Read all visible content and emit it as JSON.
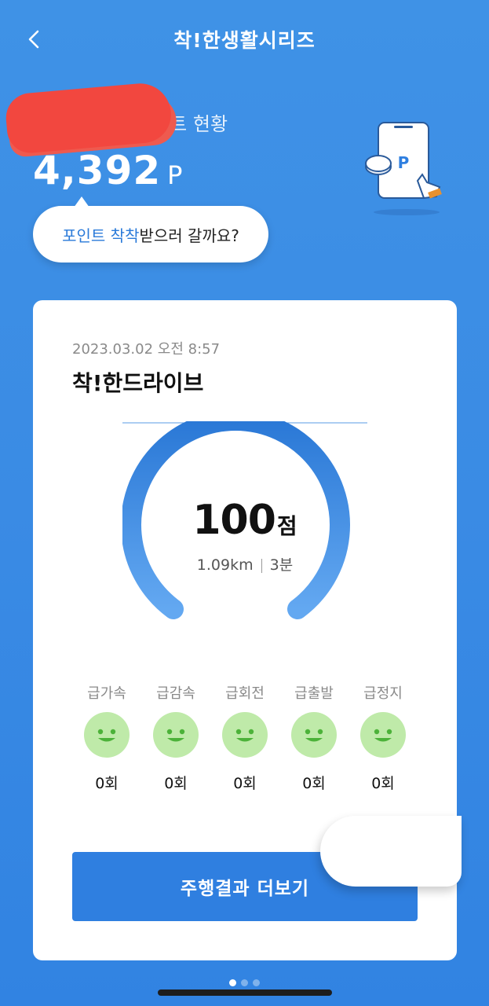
{
  "header": {
    "title": "착!한생활시리즈"
  },
  "points": {
    "label_visible": "포인트 현황",
    "value": "4,392",
    "unit": "P",
    "illustration_letter": "P"
  },
  "bubble": {
    "accent": "포인트 착착",
    "rest": " 받으러 갈까요?"
  },
  "card": {
    "date": "2023.03.02 오전 8:57",
    "title": "착!한드라이브",
    "score": {
      "value": "100",
      "unit": "점",
      "distance": "1.09km",
      "duration": "3분"
    },
    "metrics": [
      {
        "label": "급가속",
        "count": "0회"
      },
      {
        "label": "급감속",
        "count": "0회"
      },
      {
        "label": "급회전",
        "count": "0회"
      },
      {
        "label": "급출발",
        "count": "0회"
      },
      {
        "label": "급정지",
        "count": "0회"
      }
    ],
    "cta_label": "주행결과 더보기"
  },
  "pager": {
    "count": 3,
    "active_index": 0
  },
  "colors": {
    "background": "#3a8be4",
    "accent": "#2f7fe0",
    "gauge_start": "#2a78d6",
    "gauge_end": "#63a8f1",
    "smile_fill": "#bfeaa9",
    "smile_face": "#4cb239",
    "redaction": "#f2473f"
  },
  "icons": {
    "back": "chevron-left-icon",
    "smile": "smiley-face-icon",
    "illustration": "phone-points-illustration"
  }
}
